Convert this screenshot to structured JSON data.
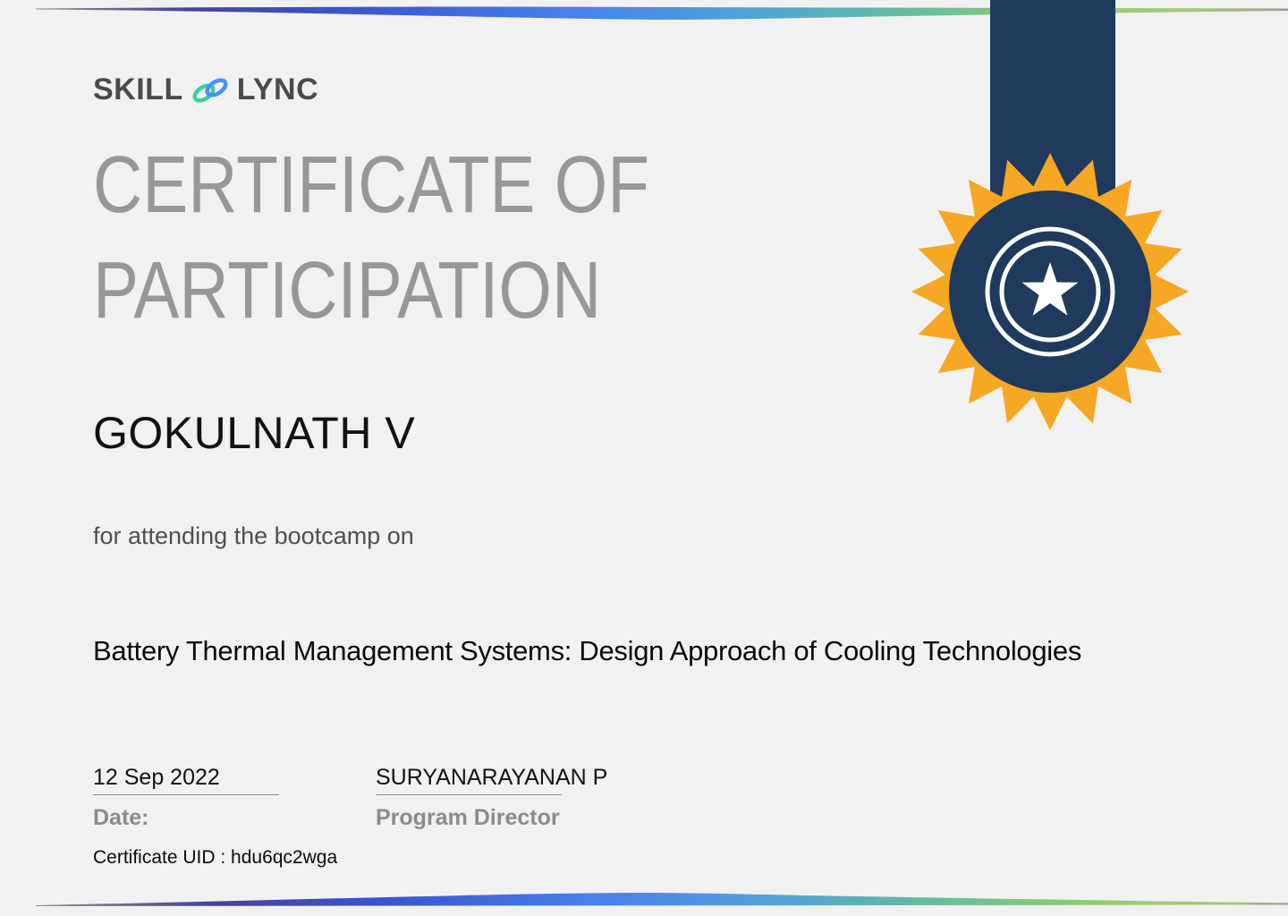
{
  "brand": {
    "word1": "SKILL",
    "word2": "LYNC"
  },
  "title": {
    "line1": "CERTIFICATE OF",
    "line2": "PARTICIPATION"
  },
  "recipient": "GOKULNATH V",
  "subtitle": "for attending the bootcamp on",
  "course": "Battery Thermal Management Systems: Design Approach of Cooling Technologies",
  "footer": {
    "date_value": "12 Sep 2022",
    "date_label": "Date:",
    "signer_name": "SURYANARAYANAN P",
    "signer_title": "Program Director",
    "uid": "Certificate UID : hdu6qc2wga"
  },
  "colors": {
    "background": "#f2f1f1",
    "navy": "#1f3a5d",
    "orange": "#f6a723",
    "white": "#ffffff",
    "link_green": "#3ccf9f",
    "link_blue": "#4a90f5",
    "heading_gray": "#97969a"
  }
}
